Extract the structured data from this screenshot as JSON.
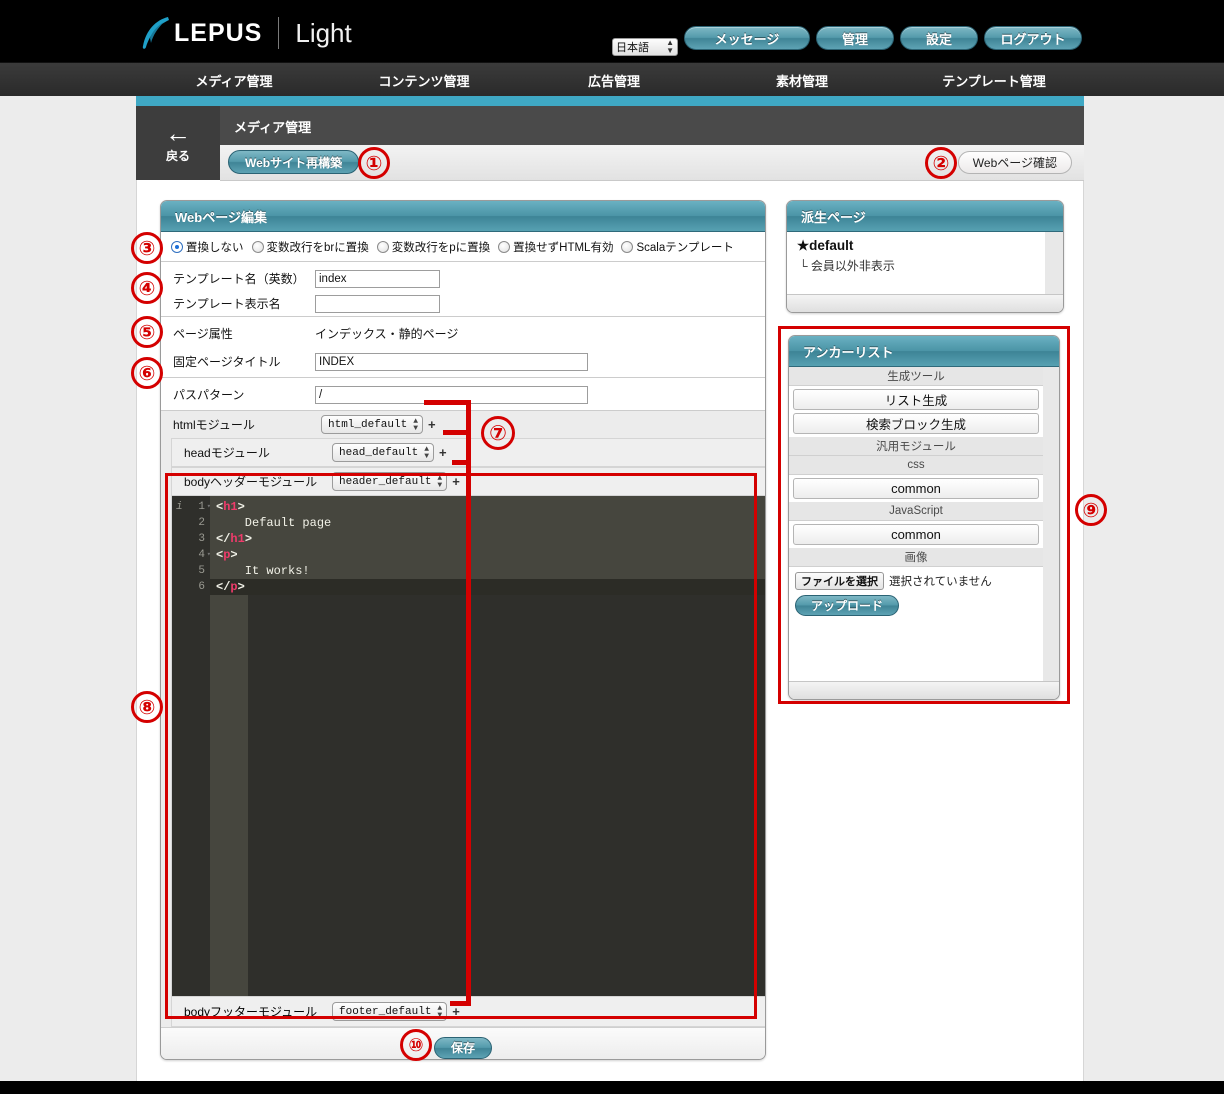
{
  "header": {
    "brand": "LEPUS",
    "product": "Light",
    "language": "日本語",
    "buttons": [
      {
        "id": "message",
        "label": "メッセージ"
      },
      {
        "id": "admin",
        "label": "管理"
      },
      {
        "id": "settings",
        "label": "設定"
      },
      {
        "id": "logout",
        "label": "ログアウト"
      }
    ]
  },
  "nav": {
    "items": [
      {
        "id": "media",
        "label": "メディア管理"
      },
      {
        "id": "contents",
        "label": "コンテンツ管理"
      },
      {
        "id": "ads",
        "label": "広告管理"
      },
      {
        "id": "assets",
        "label": "素材管理"
      },
      {
        "id": "template",
        "label": "テンプレート管理"
      }
    ]
  },
  "subheader": {
    "title": "メディア管理",
    "back_label": "戻る",
    "back_icon": "arrow-left-icon"
  },
  "toolbar": {
    "rebuild_label": "Webサイト再構築",
    "check_label": "Webページ確認"
  },
  "main_panel": {
    "title": "Webページ編集",
    "radio_options": [
      {
        "id": "no-replace",
        "label": "置換しない",
        "selected": true
      },
      {
        "id": "br-replace",
        "label": "変数改行をbrに置換",
        "selected": false
      },
      {
        "id": "p-replace",
        "label": "変数改行をpに置換",
        "selected": false
      },
      {
        "id": "html-enable",
        "label": "置換せずHTML有効",
        "selected": false
      },
      {
        "id": "scala-template",
        "label": "Scalaテンプレート",
        "selected": false
      }
    ],
    "fields": [
      {
        "id": "template-name",
        "label": "テンプレート名（英数）",
        "value": "index",
        "type": "text"
      },
      {
        "id": "template-display-name",
        "label": "テンプレート表示名",
        "value": "",
        "type": "text"
      },
      {
        "id": "page-attribute",
        "label": "ページ属性",
        "value": "インデックス・静的ページ",
        "type": "static"
      },
      {
        "id": "fixed-page-title",
        "label": "固定ページタイトル",
        "value": "INDEX",
        "type": "text"
      },
      {
        "id": "path-pattern",
        "label": "パスパターン",
        "value": "/",
        "type": "text"
      }
    ],
    "modules": [
      {
        "id": "html-module",
        "label": "htmlモジュール",
        "value": "html_default",
        "plus": "+"
      },
      {
        "id": "head-module",
        "label": "headモジュール",
        "value": "head_default",
        "plus": "+"
      },
      {
        "id": "body-header-module",
        "label": "bodyヘッダーモジュール",
        "value": "header_default",
        "plus": "+"
      },
      {
        "id": "body-footer-module",
        "label": "bodyフッターモジュール",
        "value": "footer_default",
        "plus": "+"
      }
    ],
    "editor": {
      "lines": [
        {
          "num": "1",
          "fold": true,
          "info": true,
          "html": "<span class=\"brk\">&lt;</span><span class=\"tg\">h1</span><span class=\"brk\">&gt;</span>"
        },
        {
          "num": "2",
          "fold": false,
          "info": false,
          "html": "    Default page"
        },
        {
          "num": "3",
          "fold": false,
          "info": false,
          "html": "<span class=\"brk\">&lt;/</span><span class=\"tg\">h1</span><span class=\"brk\">&gt;</span>"
        },
        {
          "num": "4",
          "fold": true,
          "info": false,
          "html": "<span class=\"brk\">&lt;</span><span class=\"tg\">p</span><span class=\"brk\">&gt;</span>"
        },
        {
          "num": "5",
          "fold": false,
          "info": false,
          "html": "    It works!"
        },
        {
          "num": "6",
          "fold": false,
          "info": false,
          "current": true,
          "html": "<span class=\"brk\">&lt;/</span><span class=\"tg\">p</span><span class=\"brk\">&gt;</span>"
        }
      ],
      "plain_text": "<h1>\n    Default page\n</h1>\n<p>\n    It works!\n</p>"
    },
    "save_label": "保存"
  },
  "derived_panel": {
    "title": "派生ページ",
    "items": [
      {
        "id": "default",
        "label": "★default",
        "primary": true
      },
      {
        "id": "member-only-hidden",
        "label": "└ 会員以外非表示",
        "primary": false
      }
    ]
  },
  "anchor_panel": {
    "title": "アンカーリスト",
    "sections": [
      {
        "id": "generation-tools",
        "label": "生成ツール",
        "buttons": [
          {
            "id": "list-generate",
            "label": "リスト生成"
          },
          {
            "id": "search-block-generate",
            "label": "検索ブロック生成"
          }
        ]
      },
      {
        "id": "generic-modules",
        "label": "汎用モジュール",
        "buttons": []
      },
      {
        "id": "css",
        "label": "css",
        "buttons": [
          {
            "id": "css-common",
            "label": "common"
          }
        ]
      },
      {
        "id": "javascript",
        "label": "JavaScript",
        "buttons": [
          {
            "id": "js-common",
            "label": "common"
          }
        ]
      },
      {
        "id": "image",
        "label": "画像",
        "buttons": []
      }
    ],
    "file_button_label": "ファイルを選択",
    "file_status": "選択されていません",
    "upload_label": "アップロード"
  },
  "annotations": [
    {
      "id": "1",
      "label": "①"
    },
    {
      "id": "2",
      "label": "②"
    },
    {
      "id": "3",
      "label": "③"
    },
    {
      "id": "4",
      "label": "④"
    },
    {
      "id": "5",
      "label": "⑤"
    },
    {
      "id": "6",
      "label": "⑥"
    },
    {
      "id": "7",
      "label": "⑦"
    },
    {
      "id": "8",
      "label": "⑧"
    },
    {
      "id": "9",
      "label": "⑨"
    },
    {
      "id": "10",
      "label": "⑩"
    }
  ],
  "colors": {
    "accent_teal": "#4b94a6",
    "strip_teal": "#3fa8c4",
    "annotation_red": "#d40000",
    "nav_dark": "#2f2f2f"
  }
}
